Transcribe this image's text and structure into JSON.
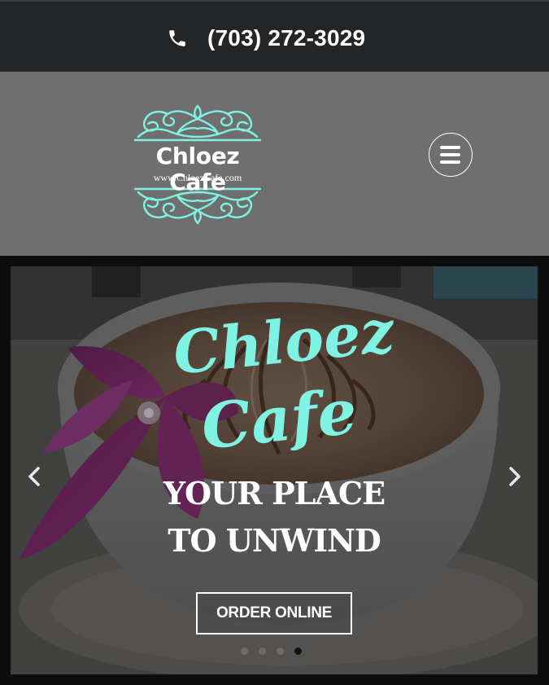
{
  "topbar": {
    "phone": "(703) 272-3029",
    "phone_icon": "phone-icon"
  },
  "header": {
    "logo_name": "Chloez Cafe",
    "logo_url": "www.ChloezCafe.com",
    "menu_icon": "hamburger-menu-icon"
  },
  "hero": {
    "script_line1": "Chloez",
    "script_line2": "Cafe",
    "tagline_line1": "YOUR PLACE",
    "tagline_line2": "TO UNWIND",
    "order_label": "ORDER ONLINE",
    "prev_icon": "chevron-left-icon",
    "next_icon": "chevron-right-icon",
    "slide_count": 4,
    "active_slide": 4
  },
  "colors": {
    "topbar_bg": "#232527",
    "header_bg": "#6f6f6f",
    "accent_turquoise": "#7ff2e3",
    "text_white": "#ffffff"
  }
}
